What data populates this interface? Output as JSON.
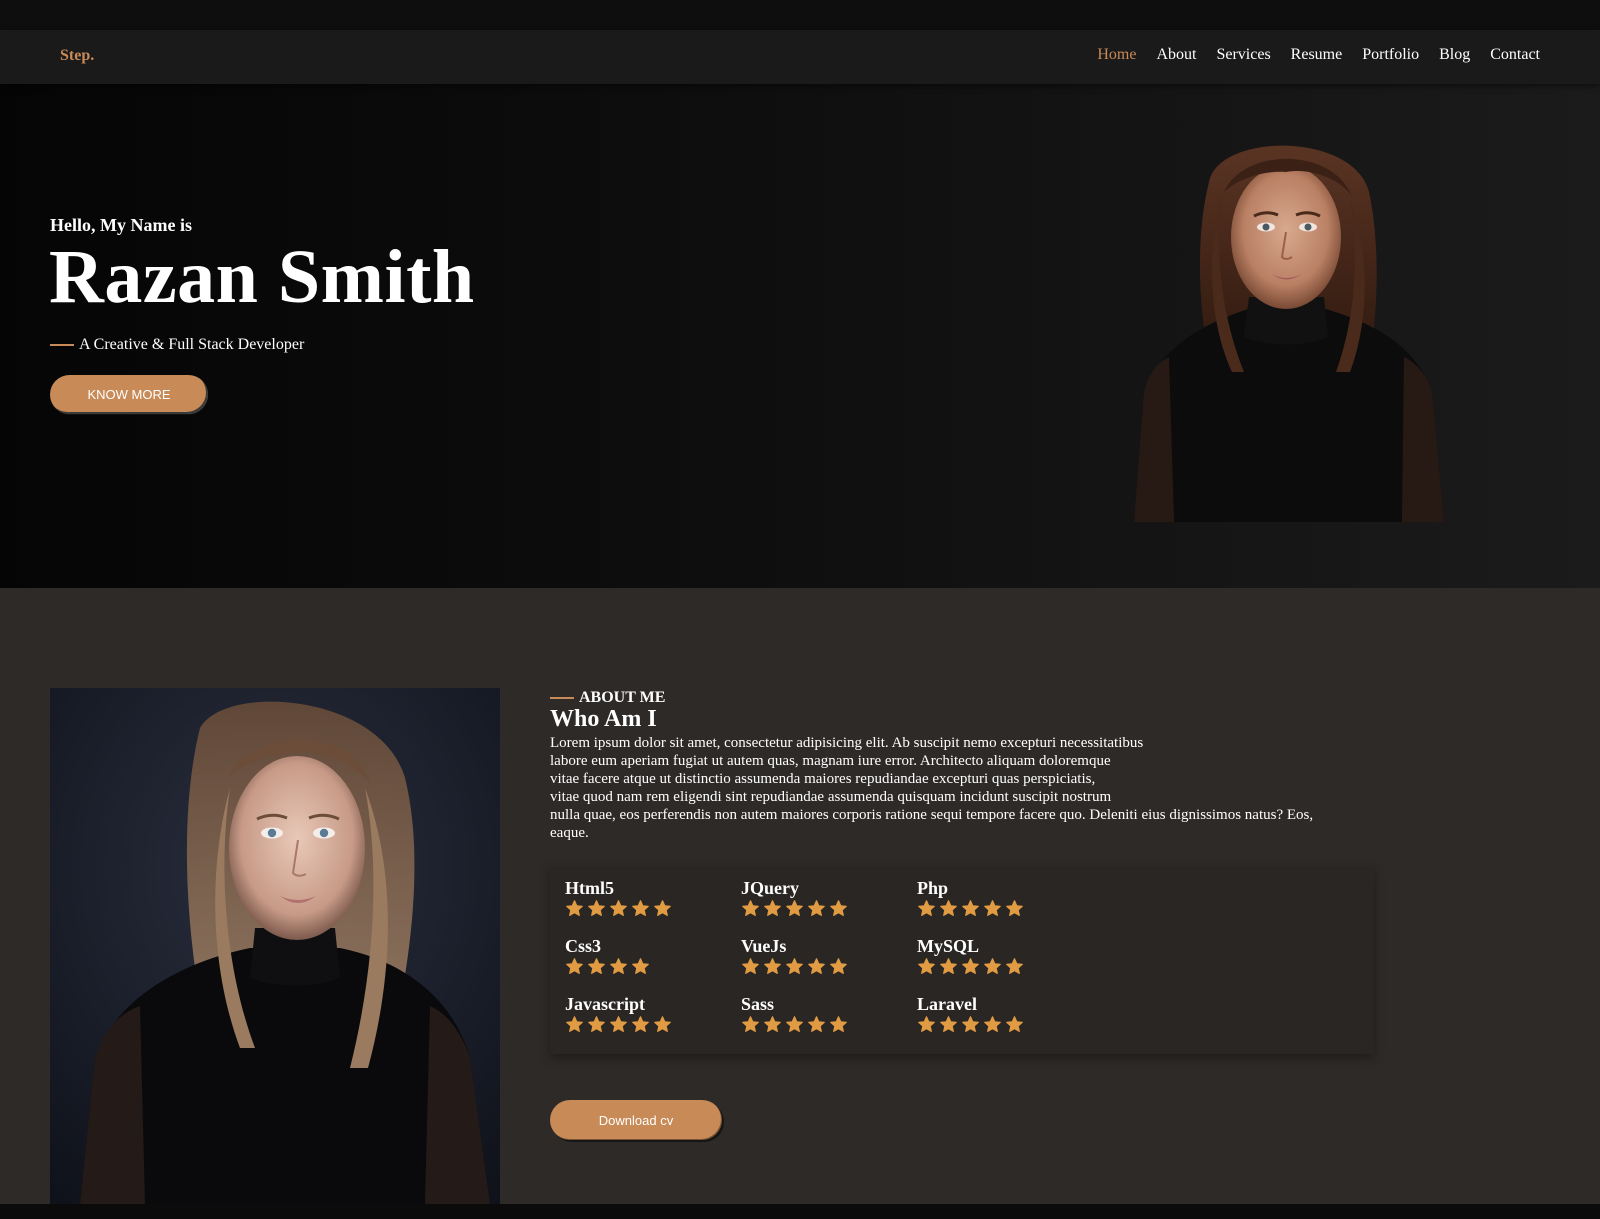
{
  "nav": {
    "brand": "Step.",
    "links": [
      "Home",
      "About",
      "Services",
      "Resume",
      "Portfolio",
      "Blog",
      "Contact"
    ],
    "active": "Home"
  },
  "hero": {
    "greeting": "Hello, My Name is",
    "name": "Razan Smith",
    "tagline": "A Creative & Full Stack Developer",
    "button_label": "KNOW MORE"
  },
  "about": {
    "eyebrow": "ABOUT ME",
    "title": "Who Am I",
    "paragraph_lines": [
      "Lorem ipsum dolor sit amet, consectetur adipisicing elit. Ab suscipit nemo excepturi necessitatibus",
      "labore eum aperiam fugiat ut autem quas, magnam iure error. Architecto aliquam doloremque",
      "vitae facere atque ut distinctio assumenda maiores repudiandae excepturi quas perspiciatis,",
      "vitae quod nam rem eligendi sint repudiandae assumenda quisquam incidunt suscipit nostrum",
      "nulla quae, eos perferendis non autem maiores corporis ratione sequi tempore facere quo. Deleniti eius dignissimos natus? Eos,",
      "eaque."
    ],
    "skills": [
      {
        "name": "Html5",
        "stars": 5
      },
      {
        "name": "JQuery",
        "stars": 5
      },
      {
        "name": "Php",
        "stars": 5
      },
      {
        "name": "Css3",
        "stars": 4
      },
      {
        "name": "VueJs",
        "stars": 5
      },
      {
        "name": "MySQL",
        "stars": 5
      },
      {
        "name": "Javascript",
        "stars": 5
      },
      {
        "name": "Sass",
        "stars": 5
      },
      {
        "name": "Laravel",
        "stars": 5
      }
    ],
    "cv_button_label": "Download cv"
  },
  "colors": {
    "accent": "#c88a57",
    "star": "#e09b43",
    "hero_bg": "#0b0b0b",
    "about_bg": "#2e2a28",
    "nav_bg": "#1a1a1b"
  },
  "icons": {
    "star": "star-icon",
    "portrait": "portrait-image"
  }
}
